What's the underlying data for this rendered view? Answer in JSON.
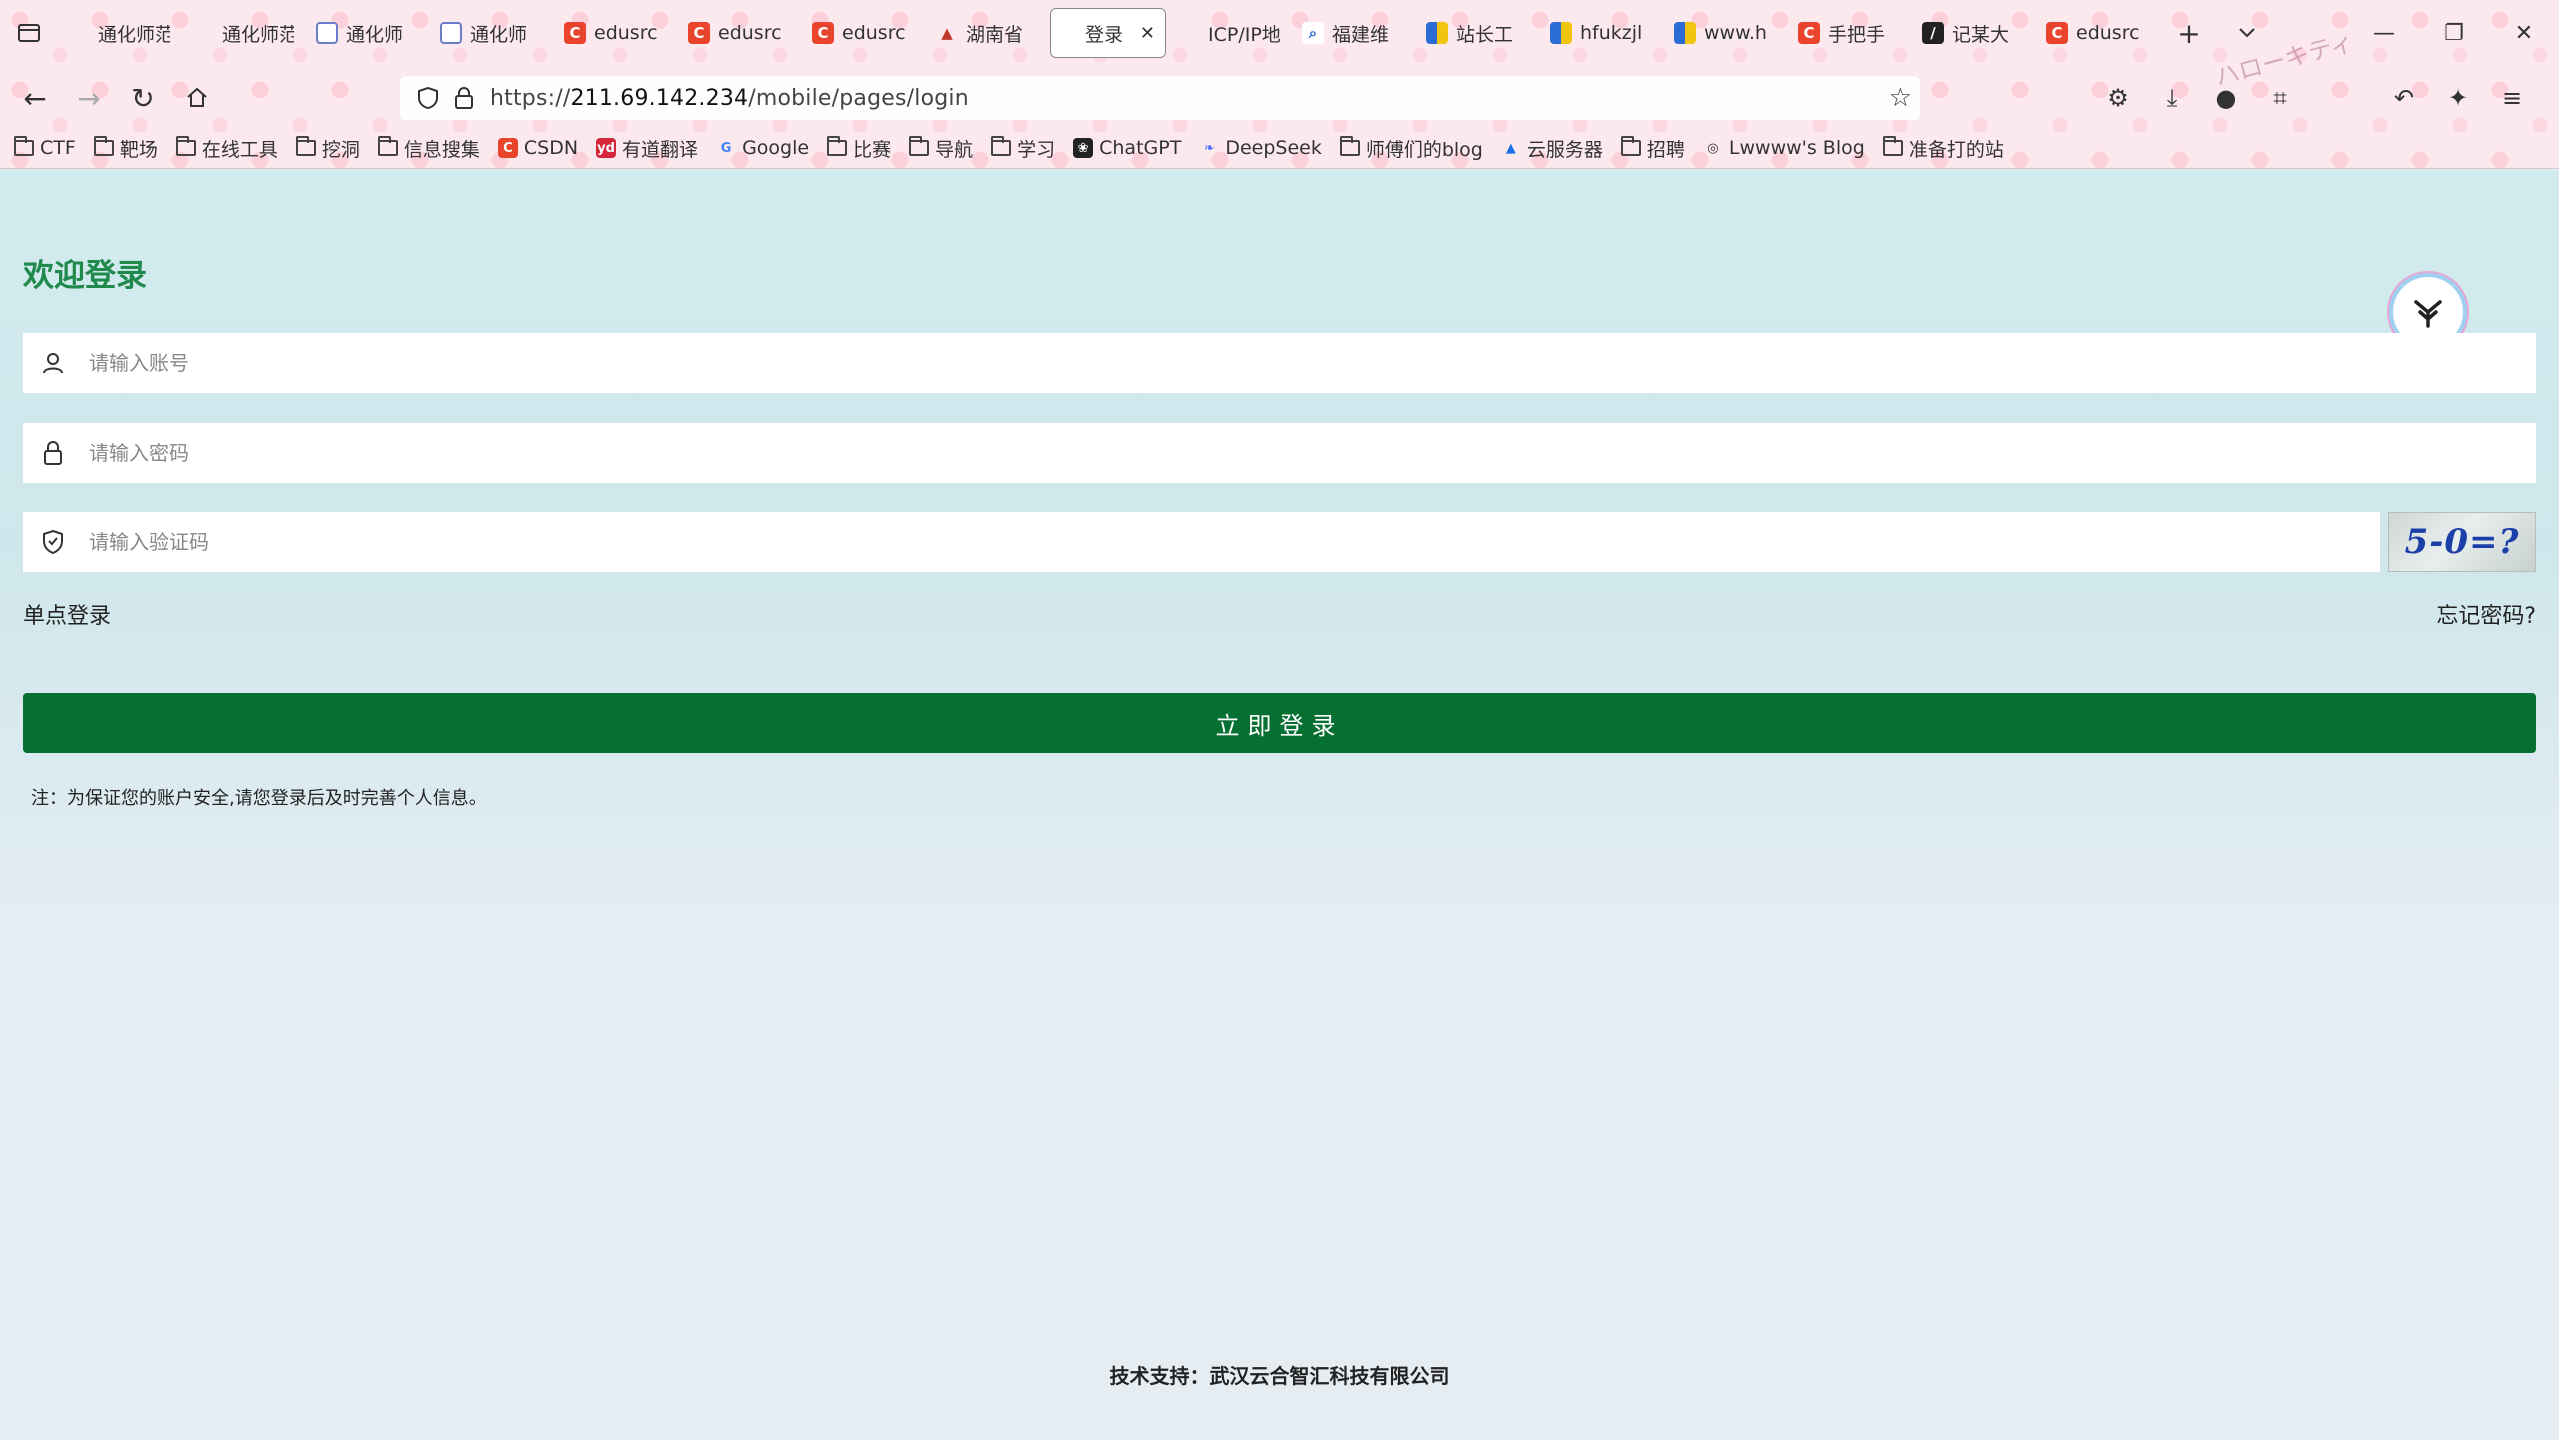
{
  "browser": {
    "tabs": [
      {
        "label": "通化师范学",
        "icon": "blank"
      },
      {
        "label": "通化师范学",
        "icon": "blank"
      },
      {
        "label": "通化师",
        "icon": "grid"
      },
      {
        "label": "通化师",
        "icon": "grid"
      },
      {
        "label": "edusrc",
        "icon": "red-c"
      },
      {
        "label": "edusrc",
        "icon": "red-c"
      },
      {
        "label": "edusrc",
        "icon": "red-c"
      },
      {
        "label": "湖南省",
        "icon": "mountain"
      },
      {
        "label": "登录",
        "icon": "blank",
        "active": true
      },
      {
        "label": "ICP/IP地址",
        "icon": "blank"
      },
      {
        "label": "福建维",
        "icon": "search"
      },
      {
        "label": "站长工",
        "icon": "multi"
      },
      {
        "label": "hfukzjl",
        "icon": "multi"
      },
      {
        "label": "www.h",
        "icon": "multi"
      },
      {
        "label": "手把手",
        "icon": "red-c"
      },
      {
        "label": "记某大",
        "icon": "dark"
      },
      {
        "label": "edusrc",
        "icon": "red-c"
      }
    ],
    "url_prefix": "https://",
    "url_host": "211.69.142.234",
    "url_path": "/mobile/pages/login",
    "bookmarks": [
      {
        "label": "CTF",
        "icon": "folder"
      },
      {
        "label": "靶场",
        "icon": "folder"
      },
      {
        "label": "在线工具",
        "icon": "folder"
      },
      {
        "label": "挖洞",
        "icon": "folder"
      },
      {
        "label": "信息搜集",
        "icon": "folder"
      },
      {
        "label": "CSDN",
        "icon": "csdn"
      },
      {
        "label": "有道翻译",
        "icon": "youdao"
      },
      {
        "label": "Google",
        "icon": "google"
      },
      {
        "label": "比赛",
        "icon": "folder"
      },
      {
        "label": "导航",
        "icon": "folder"
      },
      {
        "label": "学习",
        "icon": "folder"
      },
      {
        "label": "ChatGPT",
        "icon": "chatgpt"
      },
      {
        "label": "DeepSeek",
        "icon": "deepseek"
      },
      {
        "label": "师傅们的blog",
        "icon": "folder"
      },
      {
        "label": "云服务器",
        "icon": "cloud"
      },
      {
        "label": "招聘",
        "icon": "folder"
      },
      {
        "label": "Lwwww's Blog",
        "icon": "globe"
      },
      {
        "label": "准备打的站",
        "icon": "folder"
      }
    ],
    "hk_text": "ハローキティ"
  },
  "login": {
    "title": "欢迎登录",
    "account_placeholder": "请输入账号",
    "password_placeholder": "请输入密码",
    "captcha_placeholder": "请输入验证码",
    "captcha_text": "5-0=?",
    "sso_label": "单点登录",
    "forgot_label": "忘记密码?",
    "submit_label": "立即登录",
    "note": "注：为保证您的账户安全,请您登录后及时完善个人信息。"
  },
  "footer": {
    "text": "技术支持：武汉云合智汇科技有限公司"
  },
  "colors": {
    "title_green": "#1f8a4c",
    "button_green": "#067032"
  }
}
